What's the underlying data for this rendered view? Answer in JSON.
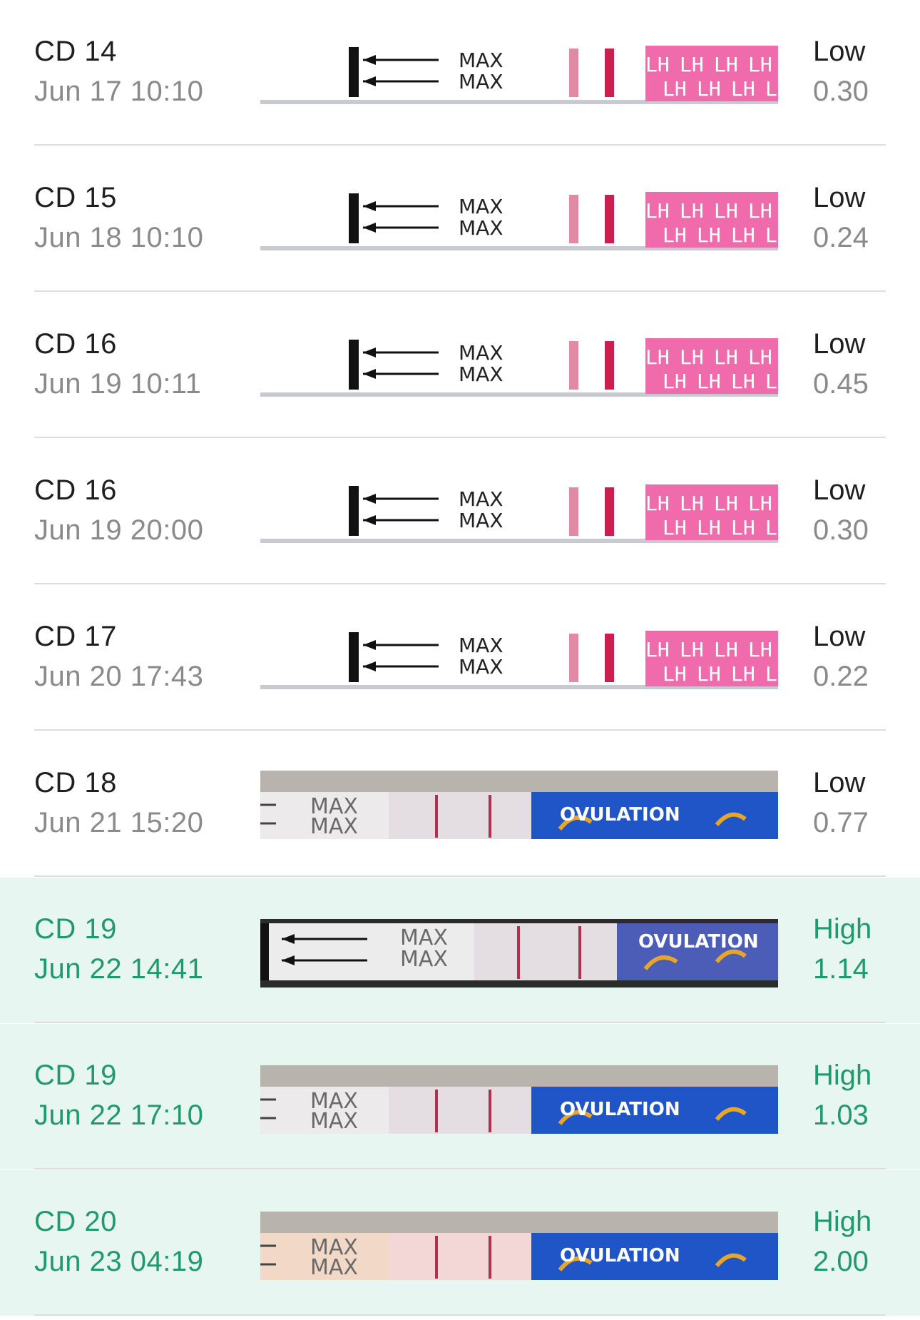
{
  "colors": {
    "high_accent": "#1f9a6e",
    "high_background": "#e7f6f1",
    "low_text": "#1f1f1f",
    "muted_text": "#8a8a8a"
  },
  "entries": [
    {
      "cycle_day": "CD 14",
      "timestamp": "Jun 17 10:10",
      "level": "Low",
      "value": "0.30",
      "strip_type": "lh-pink",
      "strip_text": "MAX",
      "strip_brand": "LH"
    },
    {
      "cycle_day": "CD 15",
      "timestamp": "Jun 18 10:10",
      "level": "Low",
      "value": "0.24",
      "strip_type": "lh-pink",
      "strip_text": "MAX",
      "strip_brand": "LH"
    },
    {
      "cycle_day": "CD 16",
      "timestamp": "Jun 19 10:11",
      "level": "Low",
      "value": "0.45",
      "strip_type": "lh-pink",
      "strip_text": "MAX",
      "strip_brand": "LH"
    },
    {
      "cycle_day": "CD 16",
      "timestamp": "Jun 19 20:00",
      "level": "Low",
      "value": "0.30",
      "strip_type": "lh-pink",
      "strip_text": "MAX",
      "strip_brand": "LH"
    },
    {
      "cycle_day": "CD 17",
      "timestamp": "Jun 20 17:43",
      "level": "Low",
      "value": "0.22",
      "strip_type": "lh-pink",
      "strip_text": "MAX",
      "strip_brand": "LH"
    },
    {
      "cycle_day": "CD 18",
      "timestamp": "Jun 21 15:20",
      "level": "Low",
      "value": "0.77",
      "strip_type": "ovulation-blue-photo",
      "strip_text": "MAX",
      "strip_brand": "OVULATION"
    },
    {
      "cycle_day": "CD 19",
      "timestamp": "Jun 22 14:41",
      "level": "High",
      "value": "1.14",
      "strip_type": "ovulation-purple-photo",
      "strip_text": "MAX",
      "strip_brand": "OVULATION"
    },
    {
      "cycle_day": "CD 19",
      "timestamp": "Jun 22 17:10",
      "level": "High",
      "value": "1.03",
      "strip_type": "ovulation-blue-photo",
      "strip_text": "MAX",
      "strip_brand": "OVULATION"
    },
    {
      "cycle_day": "CD 20",
      "timestamp": "Jun 23 04:19",
      "level": "High",
      "value": "2.00",
      "strip_type": "ovulation-blue-warm",
      "strip_text": "MAX",
      "strip_brand": "OVULATION"
    }
  ]
}
